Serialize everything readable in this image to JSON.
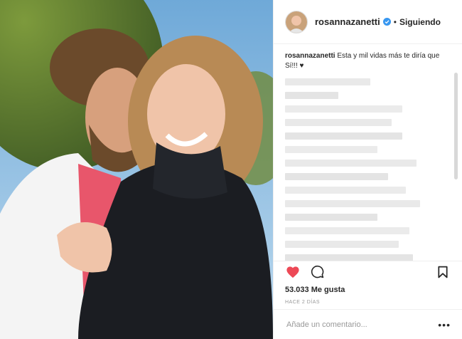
{
  "header": {
    "username": "rosannazanetti",
    "separator": "•",
    "follow_label": "Siguiendo"
  },
  "caption": {
    "username": "rosannazanetti",
    "text": "Esta y mil vidas más te diría que Sí!!! ♥"
  },
  "actions": {
    "like_icon": "heart-icon",
    "comment_icon": "comment-icon",
    "save_icon": "bookmark-icon"
  },
  "likes_text": "53.033 Me gusta",
  "date_text": "HACE 2 DÍAS",
  "comment_box": {
    "placeholder": "Añade un comentario...",
    "more_label": "•••"
  },
  "colors": {
    "like_red": "#ed4956",
    "verified_blue": "#3897f0",
    "text": "#262626",
    "muted": "#999999"
  }
}
